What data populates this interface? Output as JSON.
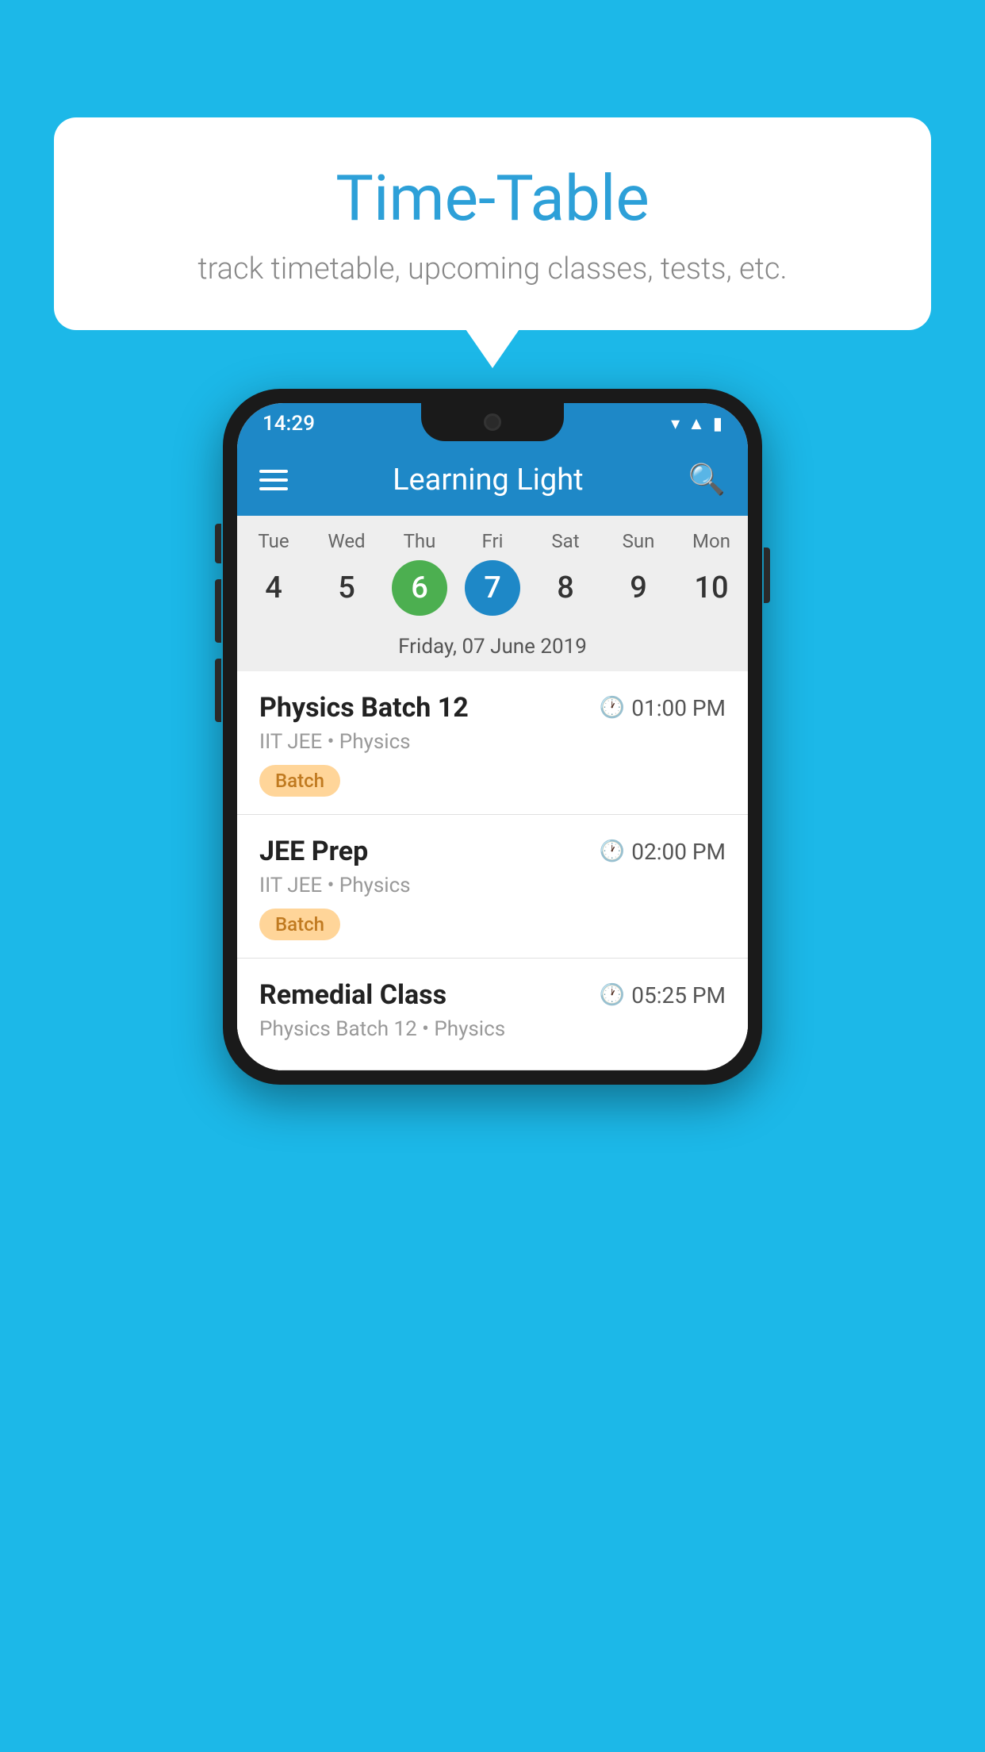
{
  "background": {
    "color": "#1cb8e8"
  },
  "speech_bubble": {
    "title": "Time-Table",
    "subtitle": "track timetable, upcoming classes, tests, etc."
  },
  "phone": {
    "status_bar": {
      "time": "14:29"
    },
    "app_bar": {
      "title": "Learning Light"
    },
    "calendar": {
      "days": [
        {
          "name": "Tue",
          "number": "4",
          "state": "normal"
        },
        {
          "name": "Wed",
          "number": "5",
          "state": "normal"
        },
        {
          "name": "Thu",
          "number": "6",
          "state": "today"
        },
        {
          "name": "Fri",
          "number": "7",
          "state": "selected"
        },
        {
          "name": "Sat",
          "number": "8",
          "state": "normal"
        },
        {
          "name": "Sun",
          "number": "9",
          "state": "normal"
        },
        {
          "name": "Mon",
          "number": "10",
          "state": "normal"
        }
      ],
      "selected_date": "Friday, 07 June 2019"
    },
    "schedule": [
      {
        "title": "Physics Batch 12",
        "time": "01:00 PM",
        "subtitle": "IIT JEE • Physics",
        "badge": "Batch"
      },
      {
        "title": "JEE Prep",
        "time": "02:00 PM",
        "subtitle": "IIT JEE • Physics",
        "badge": "Batch"
      },
      {
        "title": "Remedial Class",
        "time": "05:25 PM",
        "subtitle": "Physics Batch 12 • Physics",
        "badge": null
      }
    ]
  }
}
